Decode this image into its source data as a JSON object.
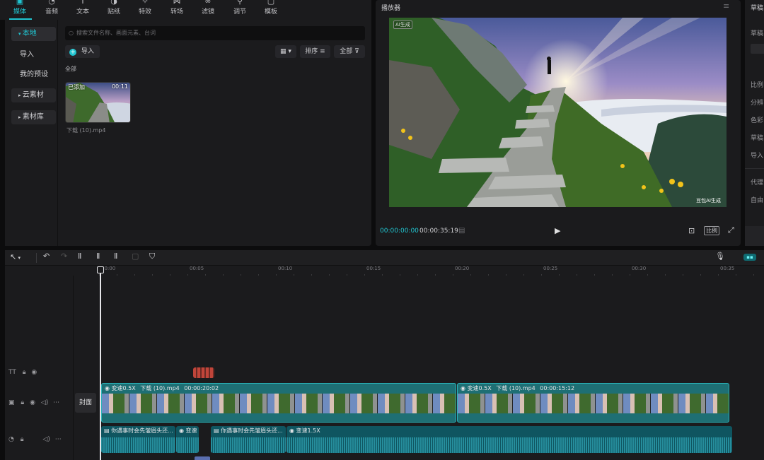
{
  "toolbar": {
    "tabs": [
      {
        "label": "媒体",
        "icon": "media-icon",
        "active": true
      },
      {
        "label": "音频",
        "icon": "audio-icon"
      },
      {
        "label": "文本",
        "icon": "text-icon"
      },
      {
        "label": "贴纸",
        "icon": "sticker-icon"
      },
      {
        "label": "特效",
        "icon": "effects-icon"
      },
      {
        "label": "转场",
        "icon": "transition-icon"
      },
      {
        "label": "滤镜",
        "icon": "filter-icon"
      },
      {
        "label": "调节",
        "icon": "adjust-icon"
      },
      {
        "label": "模板",
        "icon": "template-icon"
      }
    ]
  },
  "sidebar": {
    "items": [
      {
        "label": "本地",
        "selected": true
      },
      {
        "label": "导入"
      },
      {
        "label": "我的预设"
      },
      {
        "label": "云素材"
      },
      {
        "label": "素材库"
      }
    ]
  },
  "media": {
    "search_placeholder": "搜索文件名称、画面元素、台词",
    "import_label": "导入",
    "sort_label": "排序",
    "filter_label": "全部",
    "section_label": "全部",
    "item": {
      "badge": "已添加",
      "duration": "00:11",
      "filename": "下载 (10).mp4"
    }
  },
  "player": {
    "title": "播放器",
    "ai_badge": "AI生成",
    "watermark": "豆包AI生成",
    "current_time": "00:00:00:00",
    "total_time": "00:00:35:19",
    "ratio_label": "比例"
  },
  "right_panel": {
    "title": "草稿",
    "labels": [
      "草稿",
      "保存",
      "比例",
      "分辨",
      "色彩",
      "草稿",
      "导入",
      "代理",
      "自由"
    ]
  },
  "timeline": {
    "ruler": [
      "00:00",
      "00:05",
      "00:10",
      "00:15",
      "00:20",
      "00:25",
      "00:30",
      "00:35"
    ],
    "cover_label": "封面",
    "video_clips": [
      {
        "speed": "变速0.5X",
        "name": "下载 (10).mp4",
        "duration": "00:00:20:02"
      },
      {
        "speed": "变速0.5X",
        "name": "下载 (10).mp4",
        "duration": "00:00:15:12"
      }
    ],
    "audio_clips": [
      {
        "title": "你遇事时会先皱眉头还...",
        "speed": ""
      },
      {
        "title": "",
        "speed": "变速"
      },
      {
        "title": "你遇事时会先皱眉头还...",
        "speed": ""
      },
      {
        "title": "",
        "speed": "变速1.5X"
      }
    ]
  },
  "colors": {
    "accent": "#20c5d1",
    "clip_video": "#1e6f74",
    "clip_audio": "#0f5560",
    "text_marker": "#c0453a"
  }
}
